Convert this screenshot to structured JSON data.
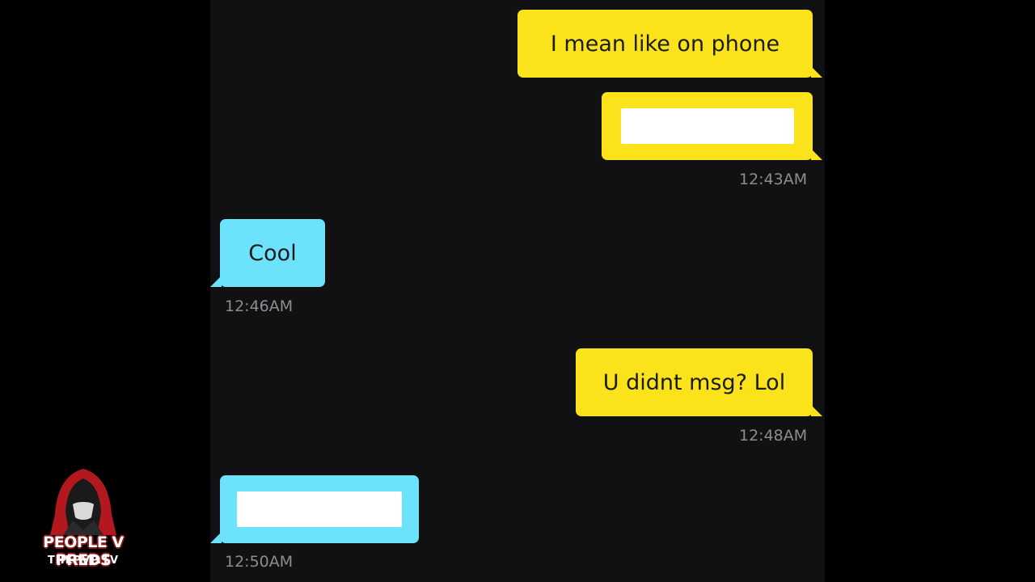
{
  "messages": [
    {
      "sender": "me",
      "text": "I mean like on phone",
      "redacted": false
    },
    {
      "sender": "me",
      "text": "",
      "redacted": true,
      "time": "12:43AM"
    },
    {
      "sender": "them",
      "text": "Cool",
      "redacted": false,
      "time": "12:46AM"
    },
    {
      "sender": "me",
      "text": "U didnt msg? Lol",
      "redacted": false,
      "time": "12:48AM"
    },
    {
      "sender": "them",
      "text": "",
      "redacted": true,
      "time": "12:50AM"
    }
  ],
  "logo": {
    "title": "PEOPLE V PREDS",
    "subtitle": "THEPVP.TV",
    "icon": "hooded-figure-icon"
  },
  "colors": {
    "outgoing_bubble": "#fbe31b",
    "incoming_bubble": "#6de2fb",
    "chat_background": "#111113",
    "timestamp": "#8d8d91",
    "frame": "#000000"
  }
}
